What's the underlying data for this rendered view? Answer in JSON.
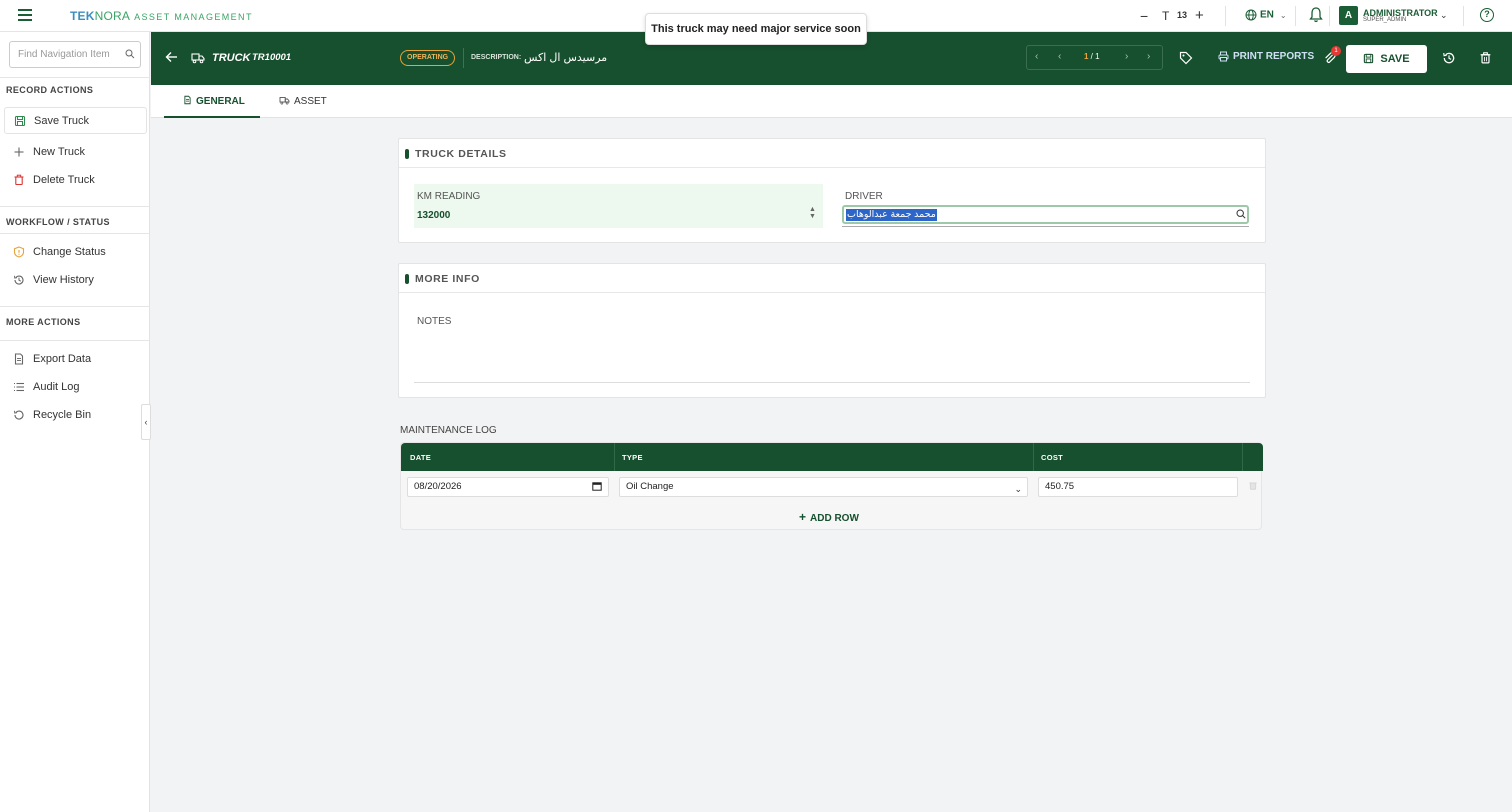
{
  "app": {
    "brand_part1": "TEK",
    "brand_part2": "NORA",
    "brand_part3": "ASSET MANAGEMENT"
  },
  "toast": "This truck may need major service soon",
  "topbar": {
    "zoom_minus": "−",
    "zoom_t": "T",
    "zoom_value": "13",
    "zoom_plus": "+",
    "language": "EN",
    "user_initial": "A",
    "user_name": "ADMINISTRATOR",
    "user_role": "SUPER_ADMIN",
    "help": "?"
  },
  "sidebar": {
    "search_placeholder": "Find Navigation Item",
    "sections": {
      "record_actions": "RECORD ACTIONS",
      "workflow_status": "WORKFLOW / STATUS",
      "more_actions": "MORE ACTIONS"
    },
    "items": {
      "save": "Save Truck",
      "new": "New Truck",
      "delete": "Delete Truck",
      "change_status": "Change Status",
      "view_history": "View History",
      "export": "Export Data",
      "audit": "Audit Log",
      "recycle": "Recycle Bin"
    },
    "collapse": "‹"
  },
  "record": {
    "type": "TRUCK",
    "id": "TR10001",
    "status": "OPERATING",
    "description_label": "DESCRIPTION:",
    "description_value": "مرسيدس ال اكس",
    "pager_current": "1",
    "pager_sep": " / ",
    "pager_total": "1",
    "print_label": "PRINT REPORTS",
    "attachments_count": "1",
    "save_label": "SAVE"
  },
  "tabs": {
    "general": "GENERAL",
    "asset": "ASSET"
  },
  "truck_details": {
    "title": "TRUCK DETAILS",
    "km_label": "KM READING",
    "km_value": "132000",
    "driver_label": "DRIVER",
    "driver_value": "محمد جمعة عبدالوهاب"
  },
  "more_info": {
    "title": "MORE INFO",
    "notes_label": "NOTES"
  },
  "maintenance": {
    "title": "MAINTENANCE LOG",
    "columns": {
      "date": "DATE",
      "type": "TYPE",
      "cost": "COST"
    },
    "rows": [
      {
        "date": "08/20/2026",
        "type": "Oil Change",
        "cost": "450.75"
      }
    ],
    "add_row": "ADD ROW"
  },
  "colors": {
    "primary": "#17502e",
    "status": "#e8a23a",
    "alert_badge": "#e53935"
  }
}
